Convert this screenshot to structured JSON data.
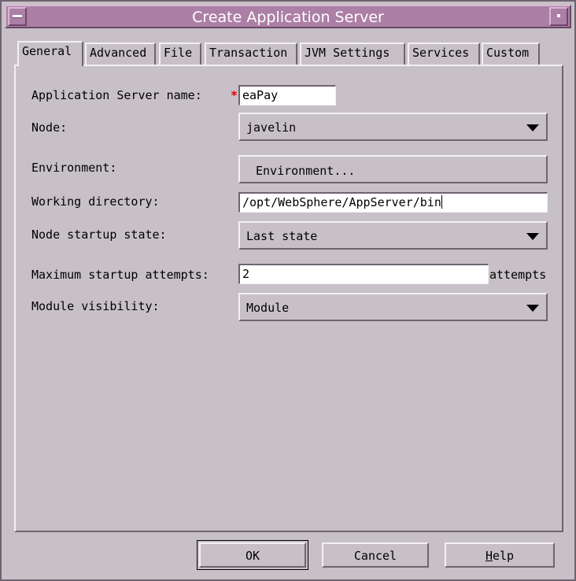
{
  "window": {
    "title": "Create Application Server"
  },
  "tabs": [
    {
      "label": "General",
      "active": true
    },
    {
      "label": "Advanced",
      "active": false
    },
    {
      "label": "File",
      "active": false
    },
    {
      "label": "Transaction",
      "active": false
    },
    {
      "label": "JVM Settings",
      "active": false
    },
    {
      "label": "Services",
      "active": false
    },
    {
      "label": "Custom",
      "active": false
    }
  ],
  "form": {
    "server_name": {
      "label": "Application Server name:",
      "required_marker": "*",
      "value": "eaPay"
    },
    "node": {
      "label": "Node:",
      "value": "javelin"
    },
    "environment": {
      "label": "Environment:",
      "button_label": "Environment..."
    },
    "working_directory": {
      "label": "Working directory:",
      "value": "/opt/WebSphere/AppServer/bin"
    },
    "node_startup_state": {
      "label": "Node startup state:",
      "value": "Last state"
    },
    "max_startup_attempts": {
      "label": "Maximum startup attempts:",
      "value": "2",
      "unit": "attempts"
    },
    "module_visibility": {
      "label": "Module visibility:",
      "value": "Module"
    }
  },
  "buttons": {
    "ok": "OK",
    "cancel": "Cancel",
    "help_mnemonic": "H",
    "help_rest": "elp"
  },
  "colors": {
    "titlebar": "#ac7fa6",
    "window_bg": "#c7c1c7",
    "required": "#e00000"
  }
}
